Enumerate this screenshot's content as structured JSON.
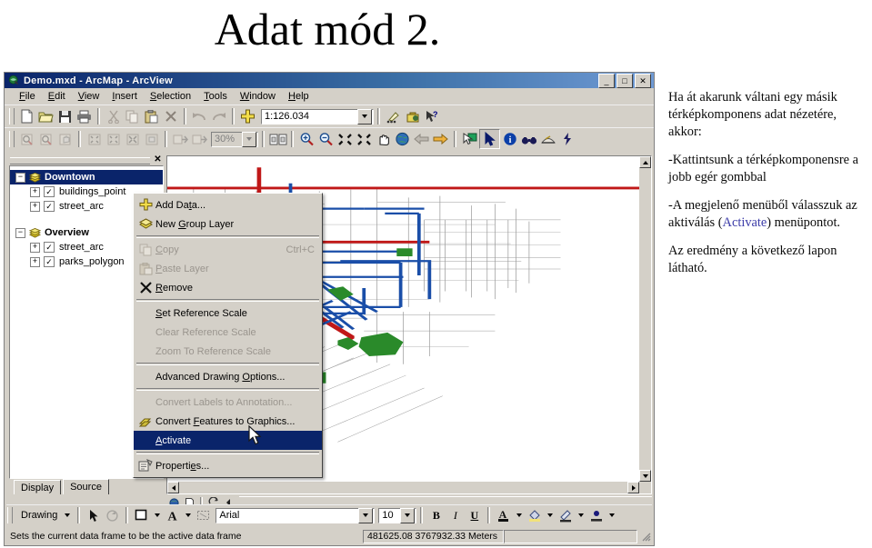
{
  "slide": {
    "title": "Adat mód 2."
  },
  "notes": {
    "p1": "Ha át akarunk váltani egy másik térképkomponens adat nézetére, akkor:",
    "p2": "-Kattintsunk a térképkomponensre a jobb egér gombbal",
    "p3_a": "-A megjelenő menüből válasszuk az aktiválás (",
    "p3_accent": "Activate",
    "p3_b": ") menüpontot.",
    "p4": "Az eredmény a következő lapon látható.",
    "accent_color": "#3b3ba8"
  },
  "app": {
    "title": "Demo.mxd - ArcMap - ArcView",
    "titlebar_color": "#0a246a",
    "window_buttons": {
      "minimize": "_",
      "maximize": "□",
      "close": "✕"
    },
    "menubar": [
      {
        "label": "File",
        "hotkey": "F"
      },
      {
        "label": "Edit",
        "hotkey": "E"
      },
      {
        "label": "View",
        "hotkey": "V"
      },
      {
        "label": "Insert",
        "hotkey": "I"
      },
      {
        "label": "Selection",
        "hotkey": "S"
      },
      {
        "label": "Tools",
        "hotkey": "T"
      },
      {
        "label": "Window",
        "hotkey": "W"
      },
      {
        "label": "Help",
        "hotkey": "H"
      }
    ],
    "standard_toolbar": {
      "icons": [
        "new-document-icon",
        "open-folder-icon",
        "save-icon",
        "print-icon",
        "cut-scissors-icon",
        "copy-icon",
        "paste-icon",
        "delete-x-icon",
        "undo-icon",
        "redo-icon",
        "add-data-icon"
      ],
      "scale_value": "1:126.034",
      "scale_placeholder": "1:126.034",
      "trailing_icons": [
        "editor-toolbar-icon",
        "arctoolbox-icon",
        "whats-this-help-icon"
      ]
    },
    "tools_toolbar": {
      "left_icons": [
        "layout-zoom-in-icon",
        "layout-zoom-out-icon",
        "layout-pan-icon",
        "fixed-zoom-in-icon",
        "fixed-zoom-out-icon",
        "zoom-whole-page-icon",
        "zoom-100-icon",
        "go-back-extent-icon",
        "go-forward-extent-icon"
      ],
      "zoom_value": "30%",
      "focus_icon": "focus-data-frame-icon",
      "right_icons": [
        "zoom-in-icon",
        "zoom-out-icon",
        "pan-icon",
        "full-extent-icon",
        "globe-icon",
        "back-extent-icon",
        "forward-extent-icon",
        "select-features-icon",
        "select-elements-icon",
        "identify-icon",
        "find-icon",
        "measure-icon",
        "hyperlink-icon"
      ]
    },
    "toc": {
      "close_label": "✕",
      "layers": [
        {
          "name": "Downtown",
          "type": "dataframe",
          "expander": "−",
          "selected": true,
          "checked": null
        },
        {
          "name": "buildings_point",
          "type": "layer",
          "expander": "+",
          "checked": true
        },
        {
          "name": "street_arc",
          "type": "layer",
          "expander": "+",
          "checked": true
        },
        {
          "name": "Overview",
          "type": "dataframe",
          "expander": "−",
          "selected": false,
          "checked": null
        },
        {
          "name": "street_arc",
          "type": "layer",
          "expander": "+",
          "checked": true
        },
        {
          "name": "parks_polygon",
          "type": "layer",
          "expander": "+",
          "checked": true
        }
      ],
      "tabs": [
        {
          "label": "Display",
          "active": false
        },
        {
          "label": "Source",
          "active": true
        }
      ]
    },
    "context_menu": {
      "items": [
        {
          "label": "Add Data...",
          "hotkey": "D",
          "icon": "add-data-icon",
          "state": "normal",
          "accel": ""
        },
        {
          "label": "New Group Layer",
          "hotkey": "G",
          "icon": "new-group-layer-icon",
          "state": "normal",
          "accel": ""
        },
        {
          "separator": true
        },
        {
          "label": "Copy",
          "hotkey": "C",
          "icon": "copy-icon",
          "state": "disabled",
          "accel": "Ctrl+C"
        },
        {
          "label": "Paste Layer",
          "hotkey": "P",
          "icon": "paste-layer-icon",
          "state": "disabled",
          "accel": ""
        },
        {
          "label": "Remove",
          "hotkey": "R",
          "icon": "remove-x-icon",
          "state": "normal",
          "accel": ""
        },
        {
          "separator": true
        },
        {
          "label": "Set Reference Scale",
          "hotkey": "S",
          "icon": "",
          "state": "normal",
          "accel": ""
        },
        {
          "label": "Clear Reference Scale",
          "hotkey": "",
          "icon": "",
          "state": "disabled",
          "accel": ""
        },
        {
          "label": "Zoom To Reference Scale",
          "hotkey": "",
          "icon": "",
          "state": "disabled",
          "accel": ""
        },
        {
          "separator": true
        },
        {
          "label": "Advanced Drawing Options...",
          "hotkey": "O",
          "icon": "",
          "state": "normal",
          "accel": ""
        },
        {
          "separator": true
        },
        {
          "label": "Convert Labels to Annotation...",
          "hotkey": "",
          "icon": "",
          "state": "disabled",
          "accel": ""
        },
        {
          "label": "Convert Features to Graphics...",
          "hotkey": "F",
          "icon": "convert-features-icon",
          "state": "normal",
          "accel": ""
        },
        {
          "label": "Activate",
          "hotkey": "A",
          "icon": "",
          "state": "highlighted",
          "accel": ""
        },
        {
          "separator": true
        },
        {
          "label": "Properties...",
          "hotkey": "e",
          "icon": "properties-icon",
          "state": "normal",
          "accel": ""
        }
      ],
      "highlight_color": "#0a246a"
    },
    "draw_order_bar": {
      "icons": [
        "globe-small-icon",
        "page-small-icon",
        "refresh-icon",
        "collapse-left-icon"
      ]
    },
    "drawing_toolbar": {
      "menu_label": "Drawing",
      "icons": [
        "select-arrow-icon",
        "rotate-icon",
        "fill-color-icon",
        "font-color-icon",
        "draw-rectangle-icon"
      ],
      "font_value": "Arial",
      "font_placeholder": "Arial",
      "size_value": "10",
      "bold_label": "B",
      "italic_label": "I",
      "underline_label": "U",
      "color_icons": [
        "font-color-icon",
        "fill-color-icon",
        "line-color-icon",
        "marker-color-icon"
      ]
    },
    "statusbar": {
      "message": "Sets the current data frame to be the active data frame",
      "coordinates": "481625.08  3767932.33 Meters"
    }
  }
}
